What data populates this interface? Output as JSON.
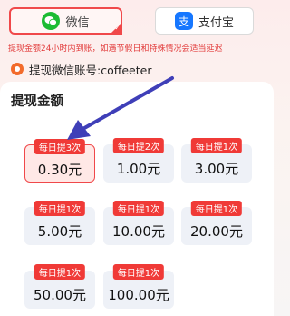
{
  "payment_methods": {
    "wechat_label": "微信",
    "alipay_label": "支付宝",
    "alipay_icon_glyph": "支"
  },
  "notice": "提现金额24小时内到账，如遇节假日和特殊情况会适当延迟",
  "account": {
    "label": "提现微信账号:",
    "value": "coffeeter"
  },
  "section_title": "提现金额",
  "options": [
    {
      "tag": "每日提3次",
      "amount": "0.30元"
    },
    {
      "tag": "每日提2次",
      "amount": "1.00元"
    },
    {
      "tag": "每日提1次",
      "amount": "3.00元"
    },
    {
      "tag": "每日提1次",
      "amount": "5.00元"
    },
    {
      "tag": "每日提1次",
      "amount": "10.00元"
    },
    {
      "tag": "每日提1次",
      "amount": "20.00元"
    },
    {
      "tag": "每日提1次",
      "amount": "50.00元"
    },
    {
      "tag": "每日提1次",
      "amount": "100.00元"
    }
  ],
  "colors": {
    "accent": "#f0484a",
    "tag_bg": "#f03a37",
    "wechat_green": "#1cbc33",
    "alipay_blue": "#1677ff",
    "annotation_arrow": "#3f3fb8"
  }
}
